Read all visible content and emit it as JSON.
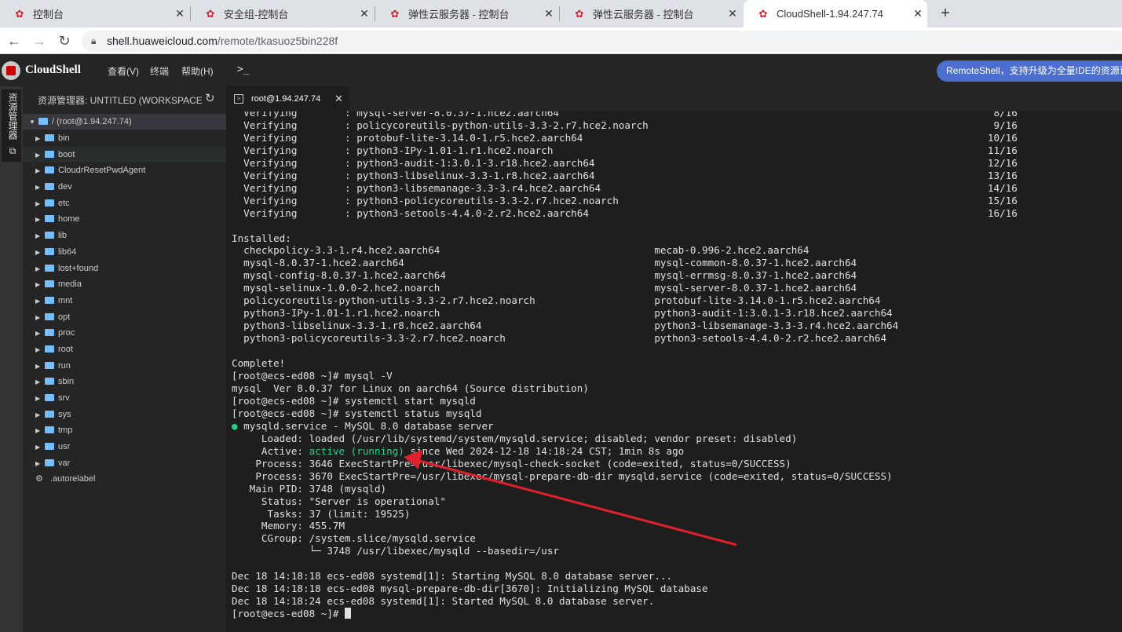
{
  "browser": {
    "tabs": [
      {
        "title": "控制台",
        "active": false
      },
      {
        "title": "安全组-控制台",
        "active": false
      },
      {
        "title": "弹性云服务器 - 控制台",
        "active": false
      },
      {
        "title": "弹性云服务器 - 控制台",
        "active": false
      },
      {
        "title": "CloudShell-1.94.247.74",
        "active": true
      }
    ],
    "url_host": "shell.huaweicloud.com",
    "url_path": "/remote/tkasuoz5bin228f"
  },
  "app": {
    "name": "CloudShell",
    "menus": [
      "查看(V)",
      "终端",
      "帮助(H)"
    ],
    "terminal_button": ">_",
    "remote_button": "RemoteShell，支持升级为全量IDE的资源调"
  },
  "activity_bar": {
    "explorer_label": "资源管理器"
  },
  "explorer": {
    "title": "资源管理器: UNTITLED (WORKSPACE)",
    "root": "/ (root@1.94.247.74)",
    "items": [
      {
        "name": "bin",
        "type": "folder"
      },
      {
        "name": "boot",
        "type": "folder"
      },
      {
        "name": "CloudrResetPwdAgent",
        "type": "folder"
      },
      {
        "name": "dev",
        "type": "folder"
      },
      {
        "name": "etc",
        "type": "folder"
      },
      {
        "name": "home",
        "type": "folder"
      },
      {
        "name": "lib",
        "type": "folder"
      },
      {
        "name": "lib64",
        "type": "folder"
      },
      {
        "name": "lost+found",
        "type": "folder"
      },
      {
        "name": "media",
        "type": "folder"
      },
      {
        "name": "mnt",
        "type": "folder"
      },
      {
        "name": "opt",
        "type": "folder"
      },
      {
        "name": "proc",
        "type": "folder"
      },
      {
        "name": "root",
        "type": "folder"
      },
      {
        "name": "run",
        "type": "folder"
      },
      {
        "name": "sbin",
        "type": "folder"
      },
      {
        "name": "srv",
        "type": "folder"
      },
      {
        "name": "sys",
        "type": "folder"
      },
      {
        "name": "tmp",
        "type": "folder"
      },
      {
        "name": "usr",
        "type": "folder"
      },
      {
        "name": "var",
        "type": "folder"
      },
      {
        "name": ".autorelabel",
        "type": "file"
      }
    ]
  },
  "terminal": {
    "tab_title": "root@1.94.247.74",
    "lines": [
      "  Verifying        : mysql-server-8.0.37-1.hce2.aarch64                                                                         8/16",
      "  Verifying        : policycoreutils-python-utils-3.3-2.r7.hce2.noarch                                                          9/16",
      "  Verifying        : protobuf-lite-3.14.0-1.r5.hce2.aarch64                                                                    10/16",
      "  Verifying        : python3-IPy-1.01-1.r1.hce2.noarch                                                                         11/16",
      "  Verifying        : python3-audit-1:3.0.1-3.r18.hce2.aarch64                                                                  12/16",
      "  Verifying        : python3-libselinux-3.3-1.r8.hce2.aarch64                                                                  13/16",
      "  Verifying        : python3-libsemanage-3.3-3.r4.hce2.aarch64                                                                 14/16",
      "  Verifying        : python3-policycoreutils-3.3-2.r7.hce2.noarch                                                              15/16",
      "  Verifying        : python3-setools-4.4.0-2.r2.hce2.aarch64                                                                   16/16",
      "",
      "Installed:",
      "  checkpolicy-3.3-1.r4.hce2.aarch64                                    mecab-0.996-2.hce2.aarch64",
      "  mysql-8.0.37-1.hce2.aarch64                                          mysql-common-8.0.37-1.hce2.aarch64",
      "  mysql-config-8.0.37-1.hce2.aarch64                                   mysql-errmsg-8.0.37-1.hce2.aarch64",
      "  mysql-selinux-1.0.0-2.hce2.noarch                                    mysql-server-8.0.37-1.hce2.aarch64",
      "  policycoreutils-python-utils-3.3-2.r7.hce2.noarch                    protobuf-lite-3.14.0-1.r5.hce2.aarch64",
      "  python3-IPy-1.01-1.r1.hce2.noarch                                    python3-audit-1:3.0.1-3.r18.hce2.aarch64",
      "  python3-libselinux-3.3-1.r8.hce2.aarch64                             python3-libsemanage-3.3-3.r4.hce2.aarch64",
      "  python3-policycoreutils-3.3-2.r7.hce2.noarch                         python3-setools-4.4.0-2.r2.hce2.aarch64",
      "",
      "Complete!",
      "[root@ecs-ed08 ~]# mysql -V",
      "mysql  Ver 8.0.37 for Linux on aarch64 (Source distribution)",
      "[root@ecs-ed08 ~]# systemctl start mysqld",
      "[root@ecs-ed08 ~]# systemctl status mysqld",
      "● mysqld.service - MySQL 8.0 database server",
      "     Loaded: loaded (/usr/lib/systemd/system/mysqld.service; disabled; vendor preset: disabled)",
      "     Active: active (running) since Wed 2024-12-18 14:18:24 CST; 1min 8s ago",
      "    Process: 3646 ExecStartPre=/usr/libexec/mysql-check-socket (code=exited, status=0/SUCCESS)",
      "    Process: 3670 ExecStartPre=/usr/libexec/mysql-prepare-db-dir mysqld.service (code=exited, status=0/SUCCESS)",
      "   Main PID: 3748 (mysqld)",
      "     Status: \"Server is operational\"",
      "      Tasks: 37 (limit: 19525)",
      "     Memory: 455.7M",
      "     CGroup: /system.slice/mysqld.service",
      "             └─ 3748 /usr/libexec/mysqld --basedir=/usr",
      "",
      "Dec 18 14:18:18 ecs-ed08 systemd[1]: Starting MySQL 8.0 database server...",
      "Dec 18 14:18:18 ecs-ed08 mysql-prepare-db-dir[3670]: Initializing MySQL database",
      "Dec 18 14:18:24 ecs-ed08 systemd[1]: Started MySQL 8.0 database server.",
      "[root@ecs-ed08 ~]# "
    ],
    "highlight": "active (running)",
    "highlight_color": "#23d18b",
    "annotation_color": "#e0202a"
  }
}
